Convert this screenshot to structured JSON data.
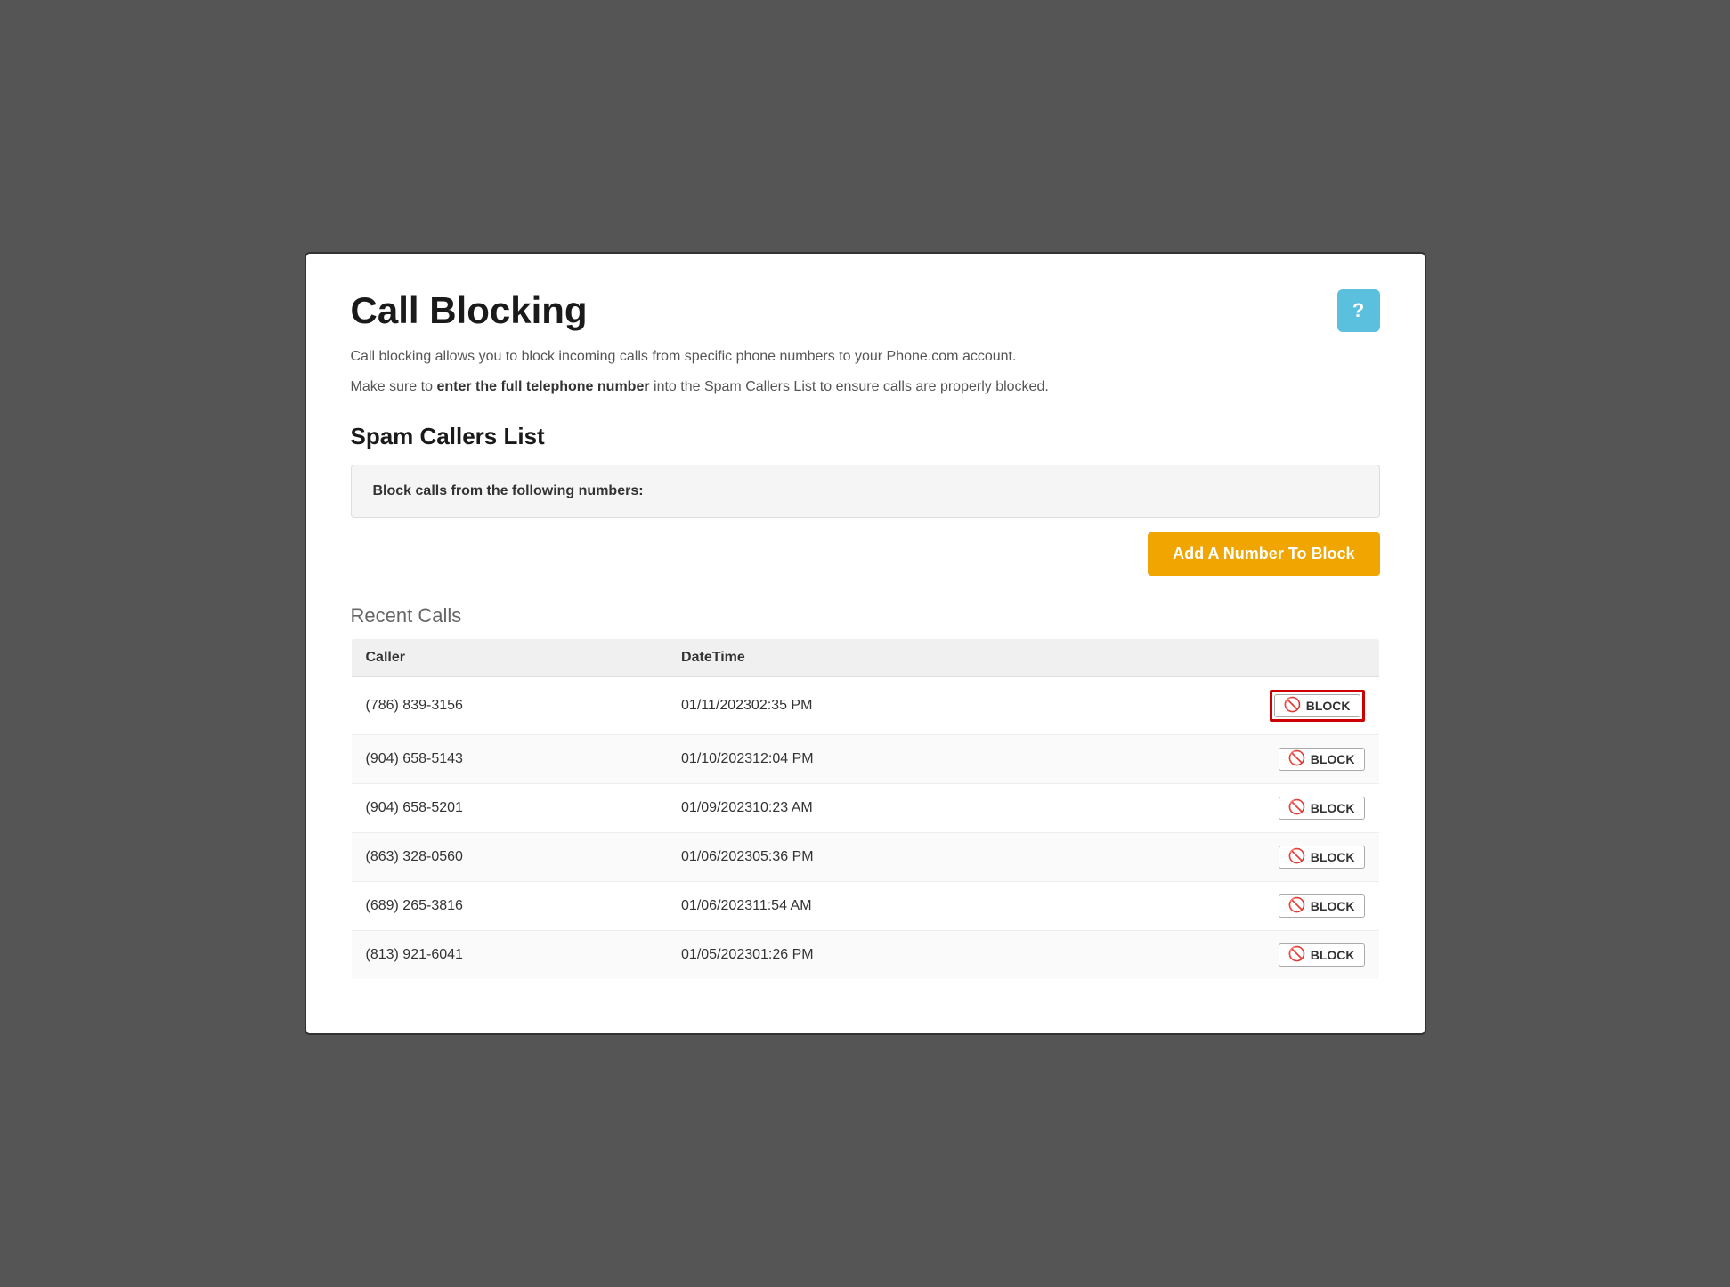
{
  "page": {
    "title": "Call Blocking",
    "help_label": "?",
    "description1": "Call blocking allows you to block incoming calls from specific phone numbers to your Phone.com account.",
    "description2_prefix": "Make sure to ",
    "description2_bold": "enter the full telephone number",
    "description2_suffix": " into the Spam Callers List to ensure calls are properly blocked.",
    "spam_callers_section_title": "Spam Callers List",
    "spam_callers_label": "Block calls from the following numbers:",
    "add_button_label": "Add A Number To Block",
    "recent_calls_title": "Recent Calls",
    "table_headers": {
      "caller": "Caller",
      "datetime": "DateTime",
      "action": ""
    },
    "block_button_label": "BLOCK",
    "recent_calls": [
      {
        "caller": "(786) 839-3156",
        "datetime": "01/11/202302:35 PM",
        "highlighted": true
      },
      {
        "caller": "(904) 658-5143",
        "datetime": "01/10/202312:04 PM",
        "highlighted": false
      },
      {
        "caller": "(904) 658-5201",
        "datetime": "01/09/202310:23 AM",
        "highlighted": false
      },
      {
        "caller": "(863) 328-0560",
        "datetime": "01/06/202305:36 PM",
        "highlighted": false
      },
      {
        "caller": "(689) 265-3816",
        "datetime": "01/06/202311:54 AM",
        "highlighted": false
      },
      {
        "caller": "(813) 921-6041",
        "datetime": "01/05/202301:26 PM",
        "highlighted": false
      }
    ]
  }
}
